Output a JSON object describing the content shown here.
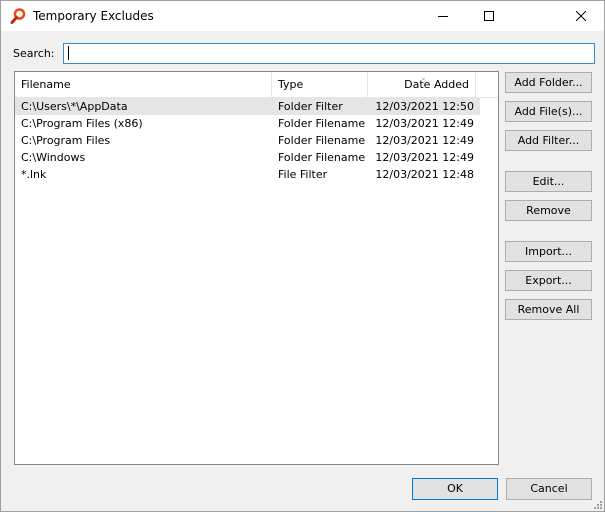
{
  "window": {
    "title": "Temporary Excludes"
  },
  "search": {
    "label": "Search:",
    "value": "",
    "placeholder": ""
  },
  "list": {
    "columns": [
      "Filename",
      "Type",
      "Date Added"
    ],
    "rows": [
      {
        "filename": "C:\\Users\\*\\AppData",
        "type": "Folder Filter",
        "date": "12/03/2021 12:50"
      },
      {
        "filename": "C:\\Program Files (x86)",
        "type": "Folder Filename",
        "date": "12/03/2021 12:49"
      },
      {
        "filename": "C:\\Program Files",
        "type": "Folder Filename",
        "date": "12/03/2021 12:49"
      },
      {
        "filename": "C:\\Windows",
        "type": "Folder Filename",
        "date": "12/03/2021 12:49"
      },
      {
        "filename": "*.lnk",
        "type": "File Filter",
        "date": "12/03/2021 12:48"
      }
    ]
  },
  "buttons": {
    "add_folder": "Add Folder...",
    "add_files": "Add File(s)...",
    "add_filter": "Add Filter...",
    "edit": "Edit...",
    "remove": "Remove",
    "import": "Import...",
    "export": "Export...",
    "remove_all": "Remove All",
    "ok": "OK",
    "cancel": "Cancel"
  },
  "colors": {
    "accent": "#0078d7",
    "selected_row": "#e5e5e5",
    "app_icon": "#e8471c"
  }
}
